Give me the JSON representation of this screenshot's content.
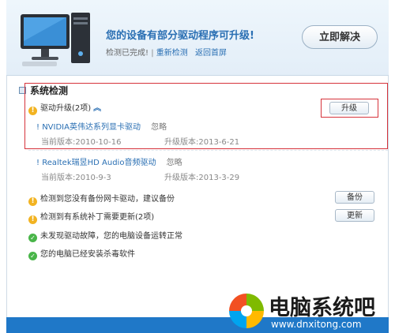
{
  "header": {
    "headline": "您的设备有部分驱动程序可升级!",
    "status": "检测已完成!",
    "redetect_link": "重新检测",
    "back_link": "返回首屏",
    "fix_button": "立即解决"
  },
  "system_check": {
    "title": "系统检测",
    "driver_upgrade": {
      "label": "驱动升级(2项)",
      "button": "升级",
      "drivers": [
        {
          "prefix": "!",
          "name": "NVIDIA英伟达系列显卡驱动",
          "ignore": "忽略",
          "current": "当前版本:2010-10-16",
          "upgrade": "升级版本:2013-6-21"
        },
        {
          "prefix": "!",
          "name": "Realtek瑞昱HD Audio音频驱动",
          "ignore": "忽略",
          "current": "当前版本:2010-9-3",
          "upgrade": "升级版本:2013-3-29"
        }
      ]
    },
    "backup": {
      "label": "检测到您没有备份网卡驱动，建议备份",
      "button": "备份"
    },
    "patch": {
      "label": "检测到有系统补丁需要更新(2项)",
      "button": "更新"
    },
    "ok_items": [
      {
        "label": "未发现驱动故障，您的电脑设备运转正常"
      },
      {
        "label": "您的电脑已经安装杀毒软件"
      }
    ]
  },
  "watermark": {
    "brand": "电脑系统吧",
    "url": "www.dnxitong.com"
  },
  "colors": {
    "accent": "#2a6fb3",
    "highlight_box": "#d6333b",
    "warning": "#f2b321",
    "ok": "#49b549"
  }
}
